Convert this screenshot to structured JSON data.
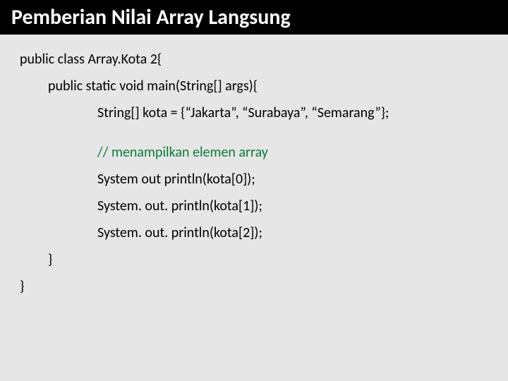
{
  "header": {
    "title": "Pemberian Nilai Array Langsung"
  },
  "code": {
    "l1": "public class Array.Kota 2{",
    "l2": "public static void main(String[] args){",
    "l3": "String[] kota = {“Jakarta”, “Surabaya”, “Semarang”};",
    "l4": "// menampilkan elemen array",
    "l5": "System out println(kota[0]);",
    "l6": "System. out. println(kota[1]);",
    "l7": "System. out. println(kota[2]);",
    "l8": "}",
    "l9": "}"
  }
}
